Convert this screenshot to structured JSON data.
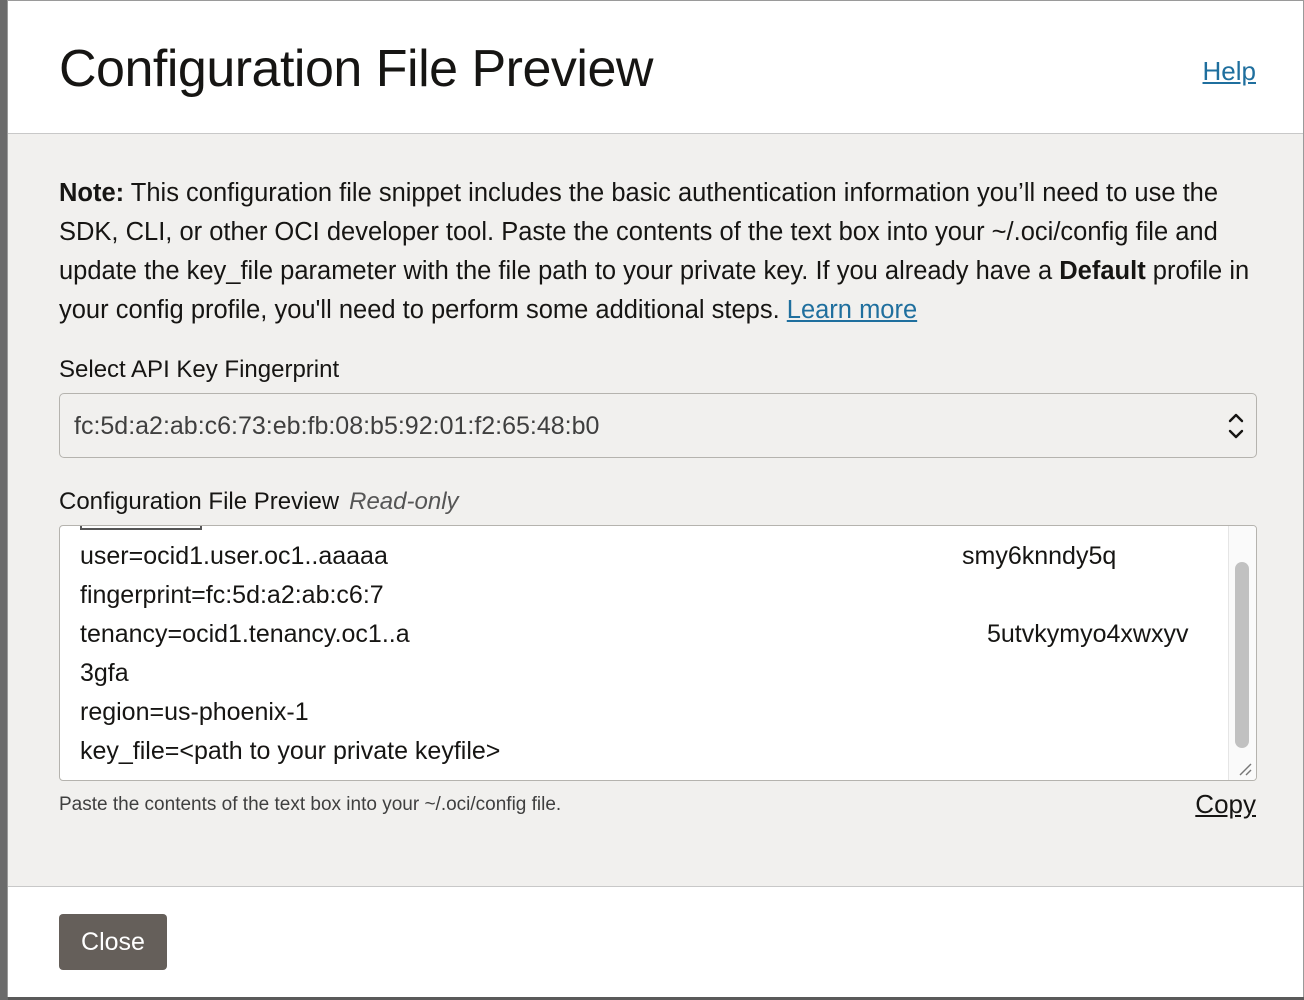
{
  "dialog": {
    "title": "Configuration File Preview",
    "help_label": "Help"
  },
  "note": {
    "bold_prefix": "Note:",
    "text": " This configuration file snippet includes the basic authentication information you’ll need to use the SDK, CLI, or other OCI developer tool. Paste the contents of the text box into your ~/.oci/config file and update the key_file parameter with the file path to your private key. If you already have a ",
    "bold_default": "Default",
    "text_after": " profile in your config profile, you'll need to perform some additional steps. ",
    "learn_more": "Learn more"
  },
  "fingerprint_select": {
    "label": "Select API Key Fingerprint",
    "selected_value": "fc:5d:a2:ab:c6:73:eb:fb:08:b5:92:01:f2:65:48:b0",
    "icon": "chevron-up-down-icon"
  },
  "preview": {
    "label": "Configuration File Preview",
    "readonly_badge": "Read-only",
    "lines": {
      "user_left": "user=ocid1.user.oc1..aaaaa",
      "user_right": "smy6knndy5q",
      "fingerprint": "fingerprint=fc:5d:a2:ab:c6:7",
      "tenancy_left": "tenancy=ocid1.tenancy.oc1..a",
      "tenancy_right": "5utvkymyo4xwxyv",
      "tenancy_cont": "3gfa",
      "region": "region=us-phoenix-1",
      "key_file": "key_file=<path to your private keyfile>"
    },
    "helper_text": "Paste the contents of the text box into your ~/.oci/config file.",
    "copy_label": "Copy"
  },
  "footer": {
    "close_label": "Close"
  }
}
